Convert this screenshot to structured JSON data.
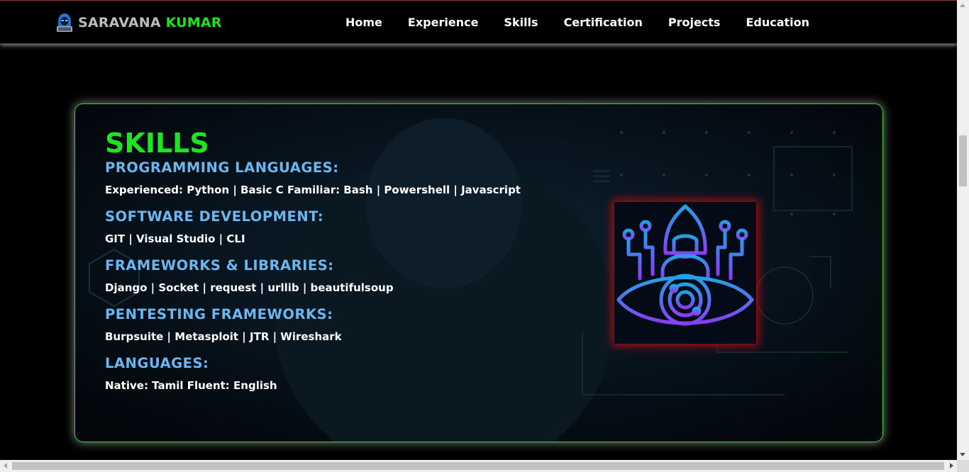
{
  "brand": {
    "first": "SARAVANA ",
    "accent": "KUMAR",
    "logo_icon": "hacker-avatar-icon"
  },
  "nav": [
    {
      "label": "Home"
    },
    {
      "label": "Experience"
    },
    {
      "label": "Skills"
    },
    {
      "label": "Certification"
    },
    {
      "label": "Projects"
    },
    {
      "label": "Education"
    }
  ],
  "skills": {
    "title": "SKILLS",
    "categories": [
      {
        "title": "PROGRAMMING LANGUAGES:",
        "items": "Experienced: Python | Basic C Familiar: Bash | Powershell | Javascript"
      },
      {
        "title": "SOFTWARE DEVELOPMENT:",
        "items": "GIT | Visual Studio | CLI"
      },
      {
        "title": "FRAMEWORKS & LIBRARIES:",
        "items": "Django | Socket | request | urllib | beautifulsoup"
      },
      {
        "title": "PENTESTING FRAMEWORKS:",
        "items": "Burpsuite | Metasploit | JTR | Wireshark"
      },
      {
        "title": "LANGUAGES:",
        "items": "Native: Tamil Fluent: English"
      }
    ],
    "illustration_icon": "cyber-eye-hacker-icon"
  },
  "colors": {
    "accent_green": "#1ee51e",
    "heading_blue": "#6cb6ef",
    "glow_red": "#d20a14",
    "icon_gradient_top": "#1fa3e6",
    "icon_gradient_bottom": "#8b3df5"
  }
}
